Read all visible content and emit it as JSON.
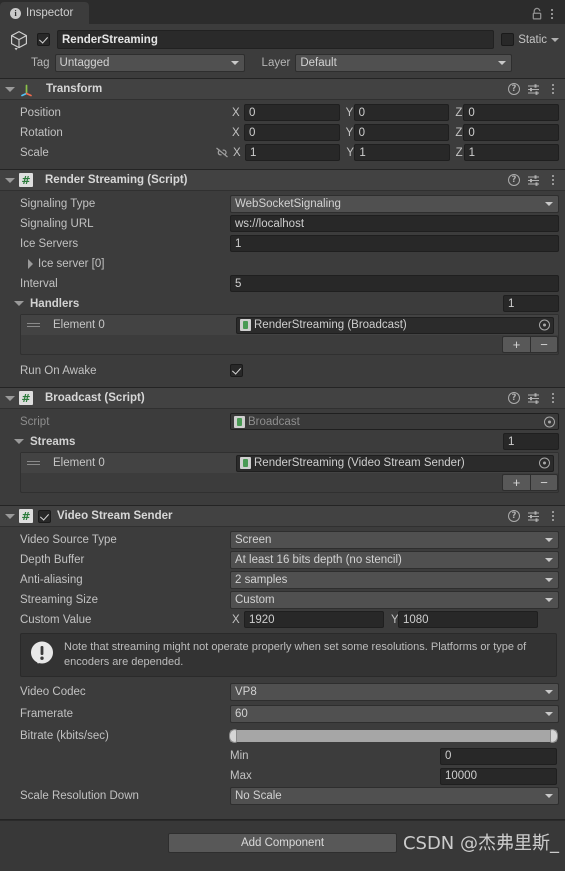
{
  "window": {
    "tab_label": "Inspector",
    "tab_icon": "info-icon",
    "lock_icon": "lock-icon",
    "menu_icon": "kebab-menu-icon"
  },
  "gameobject": {
    "enabled": true,
    "name": "RenderStreaming",
    "static_label": "Static",
    "static_checked": false,
    "tag_label": "Tag",
    "tag_value": "Untagged",
    "layer_label": "Layer",
    "layer_value": "Default"
  },
  "transform": {
    "title": "Transform",
    "rows": [
      {
        "label": "Position",
        "x": "0",
        "y": "0",
        "z": "0"
      },
      {
        "label": "Rotation",
        "x": "0",
        "y": "0",
        "z": "0"
      },
      {
        "label": "Scale",
        "x": "1",
        "y": "1",
        "z": "1"
      }
    ],
    "axis_x": "X",
    "axis_y": "Y",
    "axis_z": "Z"
  },
  "render_streaming": {
    "title": "Render Streaming (Script)",
    "signaling_type_label": "Signaling Type",
    "signaling_type_value": "WebSocketSignaling",
    "signaling_url_label": "Signaling URL",
    "signaling_url_value": "ws://localhost",
    "ice_servers_label": "Ice Servers",
    "ice_servers_value": "1",
    "ice_server_item": "Ice server [0]",
    "interval_label": "Interval",
    "interval_value": "5",
    "handlers_label": "Handlers",
    "handlers_size": "1",
    "handlers_elements": [
      {
        "label": "Element 0",
        "value": "RenderStreaming (Broadcast)"
      }
    ],
    "add_btn": "+",
    "remove_btn": "−",
    "run_on_awake_label": "Run On Awake",
    "run_on_awake_checked": true
  },
  "broadcast": {
    "title": "Broadcast (Script)",
    "script_label": "Script",
    "script_value": "Broadcast",
    "streams_label": "Streams",
    "streams_size": "1",
    "streams_elements": [
      {
        "label": "Element 0",
        "value": "RenderStreaming (Video Stream Sender)"
      }
    ],
    "add_btn": "+",
    "remove_btn": "−"
  },
  "video_stream_sender": {
    "title": "Video Stream Sender",
    "enabled": true,
    "video_source_type_label": "Video Source Type",
    "video_source_type_value": "Screen",
    "depth_buffer_label": "Depth Buffer",
    "depth_buffer_value": "At least 16 bits depth (no stencil)",
    "anti_aliasing_label": "Anti-aliasing",
    "anti_aliasing_value": "2 samples",
    "streaming_size_label": "Streaming Size",
    "streaming_size_value": "Custom",
    "custom_value_label": "Custom Value",
    "custom_value_x": "1920",
    "custom_value_y": "1080",
    "axis_x": "X",
    "axis_y": "Y",
    "note": "Note that streaming might not operate properly when set some resolutions. Platforms or type of encoders are depended.",
    "video_codec_label": "Video Codec",
    "video_codec_value": "VP8",
    "framerate_label": "Framerate",
    "framerate_value": "60",
    "bitrate_label": "Bitrate (kbits/sec)",
    "bitrate_min_label": "Min",
    "bitrate_min_value": "0",
    "bitrate_max_label": "Max",
    "bitrate_max_value": "10000",
    "scale_resolution_label": "Scale Resolution Down",
    "scale_resolution_value": "No Scale"
  },
  "footer": {
    "add_component": "Add Component",
    "watermark": "CSDN @杰弗里斯_"
  }
}
